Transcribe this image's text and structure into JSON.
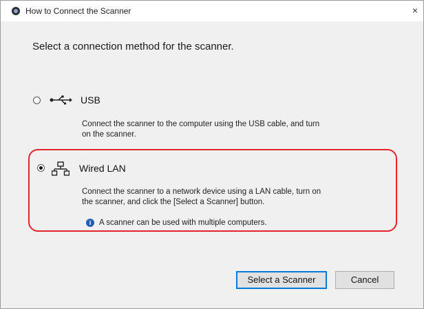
{
  "window": {
    "title": "How to Connect the Scanner",
    "close_glyph": "×"
  },
  "main": {
    "instruction": "Select a connection method for the scanner.",
    "options": [
      {
        "label": "USB",
        "icon": "usb-icon",
        "selected": false,
        "description_line1": "Connect the scanner to the computer using the USB cable, and turn",
        "description_line2": "on the scanner."
      },
      {
        "label": "Wired LAN",
        "icon": "network-icon",
        "selected": true,
        "description_line1": "Connect the scanner to a network device using a LAN cable, turn on",
        "description_line2": "the scanner, and click the [Select a Scanner] button.",
        "info_note": "A scanner can be used with multiple computers."
      }
    ]
  },
  "buttons": {
    "select_scanner": "Select a Scanner",
    "cancel": "Cancel"
  },
  "colors": {
    "highlight": "#e3242b",
    "info": "#1f5fb4",
    "dialog_bg": "#f0f0f0"
  }
}
